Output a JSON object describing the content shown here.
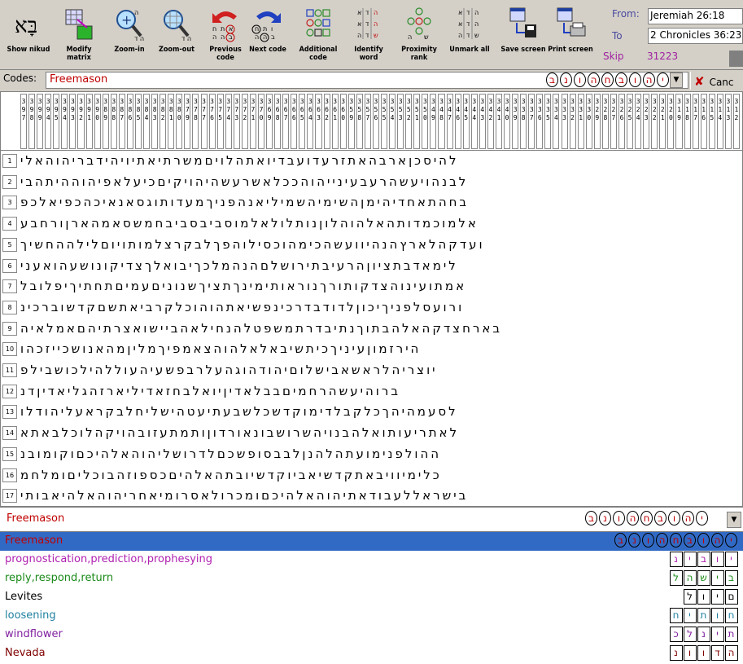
{
  "toolbar": {
    "buttons": [
      {
        "name": "show-nikud",
        "label": "Show nikud"
      },
      {
        "name": "modify-matrix",
        "label": "Modify matrix"
      },
      {
        "name": "zoom-in",
        "label": "Zoom-in"
      },
      {
        "name": "zoom-out",
        "label": "Zoom-out"
      },
      {
        "name": "previous-code",
        "label": "Previous code"
      },
      {
        "name": "next-code",
        "label": "Next code"
      },
      {
        "name": "additional-code",
        "label": "Additional code"
      },
      {
        "name": "identify-word",
        "label": "Identify word"
      },
      {
        "name": "proximity-rank",
        "label": "Proximity rank"
      },
      {
        "name": "unmark-all",
        "label": "Unmark all"
      },
      {
        "name": "save-screen",
        "label": "Save screen"
      },
      {
        "name": "print-screen",
        "label": "Print screen"
      }
    ],
    "from_label": "From:",
    "from_value": "Jeremiah 26:18",
    "to_label": "To",
    "to_value": "2 Chronicles 36:23",
    "skip_label": "Skip",
    "skip_value": "31223"
  },
  "codes": {
    "label": "Codes:",
    "value": "Freemason",
    "cancel_label": "Canc",
    "hebrew": [
      "ב",
      "נ",
      "ו",
      "ה",
      "ח",
      "ב",
      "ו",
      "ה",
      "י"
    ]
  },
  "matrix": {
    "column_headers": [
      "3\n9\n7",
      "3\n9\n8",
      "3\n9\n9",
      "3\n9\n4",
      "3\n9\n5",
      "3\n9\n4",
      "3\n9\n3",
      "3\n9\n2",
      "3\n9\n1",
      "3\n9\n0",
      "3\n8\n9",
      "3\n8\n8",
      "3\n8\n7",
      "3\n8\n6",
      "3\n8\n5",
      "3\n8\n4",
      "3\n8\n3",
      "3\n8\n2",
      "3\n8\n1",
      "3\n8\n0",
      "3\n7\n9",
      "3\n7\n8",
      "3\n7\n7",
      "3\n7\n6",
      "3\n7\n5",
      "3\n7\n4",
      "3\n7\n3",
      "3\n7\n2",
      "3\n7\n1",
      "3\n7\n0",
      "3\n6\n9",
      "3\n6\n8",
      "3\n6\n7",
      "3\n6\n6",
      "3\n6\n5",
      "3\n6\n4",
      "3\n6\n3",
      "3\n6\n2",
      "3\n6\n1",
      "3\n6\n0",
      "3\n5\n9",
      "3\n5\n8",
      "3\n5\n7",
      "3\n5\n6",
      "3\n5\n5",
      "3\n5\n4",
      "3\n5\n3",
      "3\n5\n2",
      "3\n5\n1",
      "3\n5\n0",
      "3\n4\n9",
      "3\n4\n8",
      "3\n4\n7",
      "3\n4\n6",
      "3\n4\n5",
      "3\n4\n4",
      "3\n4\n3",
      "3\n4\n2",
      "3\n4\n1",
      "3\n4\n0",
      "3\n3\n9",
      "3\n3\n8",
      "3\n3\n7",
      "3\n3\n6",
      "3\n3\n5",
      "3\n3\n4",
      "3\n3\n3",
      "3\n3\n2",
      "3\n3\n1",
      "3\n3\n0",
      "3\n2\n9",
      "3\n2\n8",
      "3\n2\n7",
      "3\n2\n6",
      "3\n2\n5",
      "3\n2\n4",
      "3\n2\n3",
      "3\n2\n2",
      "3\n2\n1",
      "3\n2\n0",
      "3\n1\n9",
      "3\n1\n8",
      "3\n1\n7",
      "3\n1\n6",
      "3\n1\n5",
      "3\n1\n4",
      "3\n1\n3",
      "3\n1\n2"
    ],
    "rows": [
      {
        "num": "1",
        "text": "להיסכןארבהאתזרעדועבדיואתהלויםמשרתיאתיויהידבריהוהאלי"
      },
      {
        "num": "2",
        "text": "לבנהויעשהרעבעינייהוהככלאשרעשהיהויקיםכיעלאפיהוההיתהבי"
      },
      {
        "num": "3",
        "text": "בחהתאחדיהימןהשימיהשמיליאנהפניךמעדותוגסאנאיכהכפיאלכפ"
      },
      {
        "num": "4",
        "text": "אלמוכמדותהאלהוהלוןנותלולאלמוסביבסביבחמשסאמהארןורחבע"
      },
      {
        "num": "5",
        "text": "ועדקהלארץהנהיוועשהכימהוכסילוהפךלבקרצלמותויוםלילההחשיך"
      },
      {
        "num": "6",
        "text": "לימאדבתציוןהרעיבתירושלםהנהמלכךיבואלךצדיקונושעהואעני"
      },
      {
        "num": "7",
        "text": "אמתועינוהצדקותורךנוראותימינךתציךשנוניםעמיםתחתיךיפלובל"
      },
      {
        "num": "8",
        "text": "ורועסלפניךיכוןלדודבדרכינפשיאתהוהוכלקרביאתשםקדשוברכינ"
      },
      {
        "num": "9",
        "text": "בארחצדקהאלהבתוךנתיבדרתמשפטלהנחילאהביישואצרתיהםאמלאיה"
      },
      {
        "num": "10",
        "text": "הירזמוןעיניךכיתשיבאלאלהוהצאמפיךמליןמהאנושכייזכהו"
      },
      {
        "num": "11",
        "text": "יוצריהלראשאבישלוםיהודהוגהעלרבפשעיהעוללהילכושבילפ"
      },
      {
        "num": "12",
        "text": "ברוהיעשהרחמיםבבלאדיןיואלבחזאדיליארזהגליאדיןדנ"
      },
      {
        "num": "13",
        "text": "לסעמהיהךכלקבלדימוקדשכלשבעתיעטהישליחלבקראעליהודלו"
      },
      {
        "num": "14",
        "text": "לאתריעותואלהבנויהשרושבונאורדוןותמתעזובהויקהלוכלבאתא"
      },
      {
        "num": "15",
        "text": "ההולפנימועתהלהנןלבבסופשכםלדרושליהוהאלהיכםוקומובנ"
      },
      {
        "num": "16",
        "text": "כלימיוויבאתקדשיאביוקדשיובתהאלהיםכספוזהבוכליםומלחמ"
      },
      {
        "num": "17",
        "text": "בישראללעבודאתיהוהאלהיכםומכרולאסרומיאחריהוהאלהיאבותי"
      }
    ]
  },
  "terms_selected": {
    "label": "Freemason",
    "hebrew": [
      "ב",
      "נ",
      "ו",
      "ה",
      "ח",
      "ב",
      "ו",
      "ה",
      "י"
    ]
  },
  "terms": [
    {
      "label": "Freemason",
      "color": "#c00000",
      "hebrew": [
        "ב",
        "נ",
        "ו",
        "ה",
        "ח",
        "ב",
        "ו",
        "ה",
        "י"
      ]
    },
    {
      "label": "prognostication,prediction,prophesying",
      "color": "#b020b0",
      "hebrew": [
        "נ",
        "י",
        "ב",
        "ו",
        "י"
      ]
    },
    {
      "label": "reply,respond,return",
      "color": "#1a8a1a",
      "hebrew": [
        "ל",
        "ה",
        "ש",
        "י",
        "ב"
      ]
    },
    {
      "label": "Levites",
      "color": "#000000",
      "hebrew": [
        "ל",
        "ו",
        "י",
        "ם"
      ]
    },
    {
      "label": "loosening",
      "color": "#2080a0",
      "hebrew": [
        "ח",
        "י",
        "ת",
        "ו",
        "ח"
      ]
    },
    {
      "label": "windflower",
      "color": "#8020a0",
      "hebrew": [
        "כ",
        "ל",
        "נ",
        "י",
        "ת"
      ]
    },
    {
      "label": "Nevada",
      "color": "#800000",
      "hebrew": [
        "נ",
        "ו",
        "ו",
        "ד",
        "ה"
      ]
    }
  ]
}
